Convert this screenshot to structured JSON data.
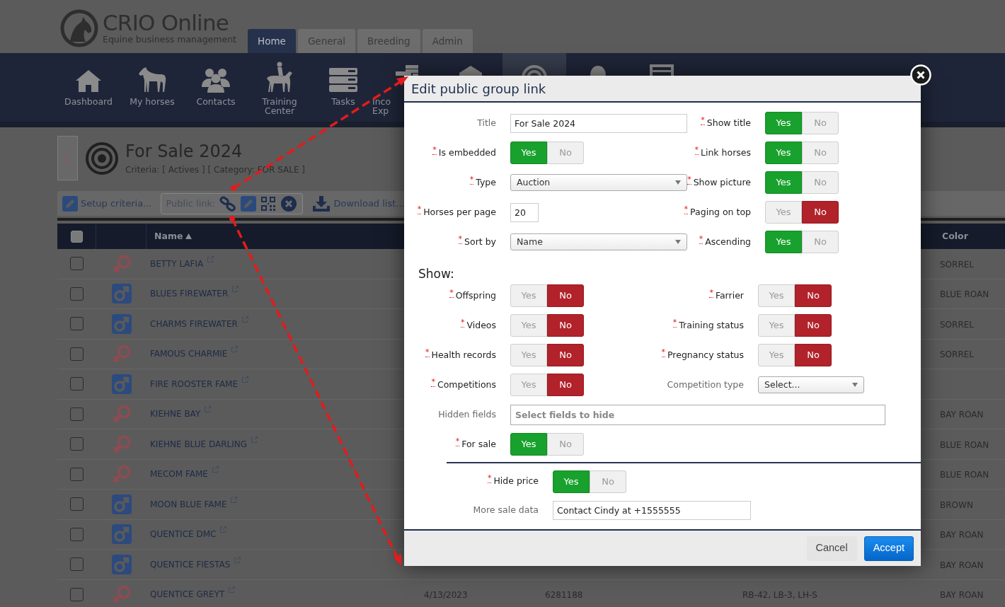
{
  "header": {
    "logo_title": "CRIO Online",
    "logo_subtitle": "Equine business management",
    "tabs": [
      {
        "label": "Home",
        "selected": true
      },
      {
        "label": "General",
        "selected": false
      },
      {
        "label": "Breeding",
        "selected": false
      },
      {
        "label": "Admin",
        "selected": false
      }
    ]
  },
  "nav": [
    {
      "label": "Dashboard",
      "selected": false
    },
    {
      "label": "My horses",
      "selected": false
    },
    {
      "label": "Contacts",
      "selected": false
    },
    {
      "label": "Training Center",
      "selected": false
    },
    {
      "label": "Tasks",
      "selected": false
    },
    {
      "label": "Inco Exp",
      "selected": false
    },
    {
      "selected": false
    },
    {
      "selected": true
    },
    {
      "selected": false
    },
    {
      "selected": false
    }
  ],
  "group": {
    "title": "For Sale 2024",
    "criteria": "Criteria: [ Actives ] [ Category: FOR SALE ]"
  },
  "toolbar": {
    "setup": "Setup criteria...",
    "public_link": "Public link:",
    "download": "Download list..."
  },
  "table": {
    "select_all_checked": false,
    "columns": [
      {
        "label": "Name",
        "sort_ascending": true
      },
      {
        "label": "Color"
      }
    ],
    "rows": [
      {
        "checked": false,
        "kind": "mare",
        "name": "BETTY LAFIA",
        "coat": "SORREL"
      },
      {
        "checked": false,
        "kind": "stallion",
        "name": "BLUES FIREWATER",
        "coat": "BLUE ROAN"
      },
      {
        "checked": false,
        "kind": "stallion",
        "name": "CHARMS FIREWATER",
        "coat": "SORREL"
      },
      {
        "checked": false,
        "kind": "mare",
        "name": "FAMOUS CHARMIE",
        "coat": "SORREL"
      },
      {
        "checked": false,
        "kind": "stallion",
        "name": "FIRE ROOSTER FAME"
      },
      {
        "checked": false,
        "kind": "mare",
        "name": "KIEHNE BAY",
        "coat": "BAY ROAN"
      },
      {
        "checked": false,
        "kind": "mare",
        "name": "KIEHNE BLUE DARLING",
        "coat": "BLUE ROAN"
      },
      {
        "checked": false,
        "kind": "mare",
        "name": "MECOM FAME",
        "coat": "BLUE ROAN"
      },
      {
        "checked": false,
        "kind": "stallion",
        "name": "MOON BLUE FAME",
        "coat": "BROWN"
      },
      {
        "checked": false,
        "kind": "stallion",
        "name": "QUENTICE DMC",
        "coat": "BAY ROAN"
      },
      {
        "checked": false,
        "kind": "stallion",
        "name": "QUENTICE FIESTAS",
        "coat": "BAY ROAN"
      },
      {
        "checked": false,
        "kind": "mare",
        "name": "QUENTICE GREYT",
        "date": "4/13/2023",
        "number": "6281188",
        "markings": "RB-42, LB-3, LH-S",
        "coat": "BAY ROAN"
      }
    ]
  },
  "modal": {
    "title": "Edit public group link",
    "required_mark": "*",
    "general_rows": [
      [
        {
          "kind": "text",
          "label": "Title",
          "required": false,
          "value": "For Sale 2024"
        },
        {
          "kind": "toggle",
          "label": "Show title",
          "required": true,
          "options": [
            {
              "label": "Yes",
              "selected": true
            },
            {
              "label": "No",
              "selected": false
            }
          ]
        }
      ],
      [
        {
          "kind": "toggle",
          "label": "Is embedded",
          "required": true,
          "options": [
            {
              "label": "Yes",
              "selected": true
            },
            {
              "label": "No",
              "selected": false
            }
          ]
        },
        {
          "kind": "toggle",
          "label": "Link horses",
          "required": true,
          "options": [
            {
              "label": "Yes",
              "selected": true
            },
            {
              "label": "No",
              "selected": false
            }
          ]
        }
      ],
      [
        {
          "kind": "select",
          "label": "Type",
          "required": true,
          "value": "Auction"
        },
        {
          "kind": "toggle",
          "label": "Show picture",
          "required": true,
          "options": [
            {
              "label": "Yes",
              "selected": true
            },
            {
              "label": "No",
              "selected": false
            }
          ]
        }
      ],
      [
        {
          "kind": "number",
          "label": "Horses per page",
          "required": true,
          "value": "20"
        },
        {
          "kind": "toggle",
          "label": "Paging on top",
          "required": true,
          "options": [
            {
              "label": "Yes",
              "selected": false
            },
            {
              "label": "No",
              "selected": true
            }
          ]
        }
      ],
      [
        {
          "kind": "select",
          "label": "Sort by",
          "required": true,
          "value": "Name"
        },
        {
          "kind": "toggle",
          "label": "Ascending",
          "required": true,
          "options": [
            {
              "label": "Yes",
              "selected": true
            },
            {
              "label": "No",
              "selected": false
            }
          ]
        }
      ]
    ],
    "show_heading": "Show:",
    "show_rows": [
      [
        {
          "kind": "toggle",
          "label": "Offspring",
          "required": true,
          "options": [
            {
              "label": "Yes",
              "selected": false
            },
            {
              "label": "No",
              "selected": true
            }
          ]
        },
        {
          "kind": "toggle",
          "label": "Farrier",
          "required": true,
          "options": [
            {
              "label": "Yes",
              "selected": false
            },
            {
              "label": "No",
              "selected": true
            }
          ]
        }
      ],
      [
        {
          "kind": "toggle",
          "label": "Videos",
          "required": true,
          "options": [
            {
              "label": "Yes",
              "selected": false
            },
            {
              "label": "No",
              "selected": true
            }
          ]
        },
        {
          "kind": "toggle",
          "label": "Training status",
          "required": true,
          "options": [
            {
              "label": "Yes",
              "selected": false
            },
            {
              "label": "No",
              "selected": true
            }
          ]
        }
      ],
      [
        {
          "kind": "toggle",
          "label": "Health records",
          "required": true,
          "options": [
            {
              "label": "Yes",
              "selected": false
            },
            {
              "label": "No",
              "selected": true
            }
          ]
        },
        {
          "kind": "toggle",
          "label": "Pregnancy status",
          "required": true,
          "options": [
            {
              "label": "Yes",
              "selected": false
            },
            {
              "label": "No",
              "selected": true
            }
          ]
        }
      ],
      [
        {
          "kind": "toggle",
          "label": "Competitions",
          "required": true,
          "options": [
            {
              "label": "Yes",
              "selected": false
            },
            {
              "label": "No",
              "selected": true
            }
          ]
        },
        {
          "kind": "select",
          "label": "Competition type",
          "required": false,
          "value": "Select..."
        }
      ],
      [
        {
          "kind": "multiselect",
          "label": "Hidden fields",
          "required": false,
          "placeholder": "Select fields to hide"
        }
      ],
      [
        {
          "kind": "toggle",
          "label": "For sale",
          "required": true,
          "options": [
            {
              "label": "Yes",
              "selected": true
            },
            {
              "label": "No",
              "selected": false
            }
          ]
        }
      ]
    ],
    "sale_rows": [
      {
        "kind": "toggle",
        "label": "Hide price",
        "required": true,
        "options": [
          {
            "label": "Yes",
            "selected": true
          },
          {
            "label": "No",
            "selected": false
          }
        ]
      },
      {
        "kind": "text",
        "label": "More sale data",
        "required": false,
        "value": "Contact Cindy at +1555555"
      }
    ],
    "buttons": [
      {
        "label": "Cancel",
        "kind": "secondary"
      },
      {
        "label": "Accept",
        "kind": "primary"
      }
    ]
  }
}
